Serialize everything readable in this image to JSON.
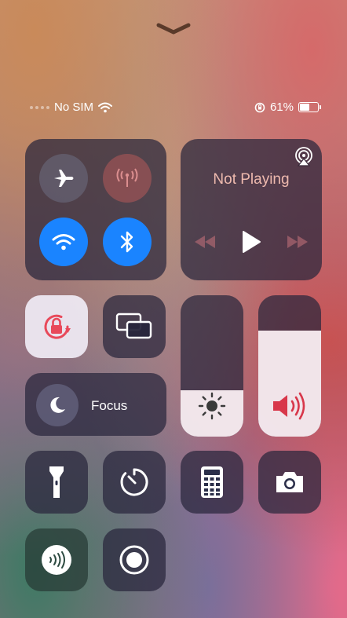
{
  "status": {
    "carrier": "No SIM",
    "battery_percent": "61%",
    "battery_level": 0.61
  },
  "connectivity": {
    "airplane_mode": false,
    "cellular_data": false,
    "wifi": true,
    "bluetooth": true
  },
  "media": {
    "now_playing": "Not Playing"
  },
  "focus": {
    "label": "Focus"
  },
  "sliders": {
    "brightness": 0.33,
    "volume": 0.75
  },
  "icons": [
    "chevron-down-icon",
    "wifi-icon",
    "orientation-lock-icon",
    "airplane-icon",
    "cellular-antenna-icon",
    "bluetooth-icon",
    "airplay-icon",
    "rewind-icon",
    "play-icon",
    "fast-forward-icon",
    "screen-mirroring-icon",
    "moon-icon",
    "sun-icon",
    "speaker-icon",
    "flashlight-icon",
    "timer-icon",
    "calculator-icon",
    "camera-icon",
    "nfc-icon",
    "screen-record-icon"
  ],
  "colors": {
    "accent_blue": "#1a84ff",
    "lock_red": "#e8495a"
  }
}
